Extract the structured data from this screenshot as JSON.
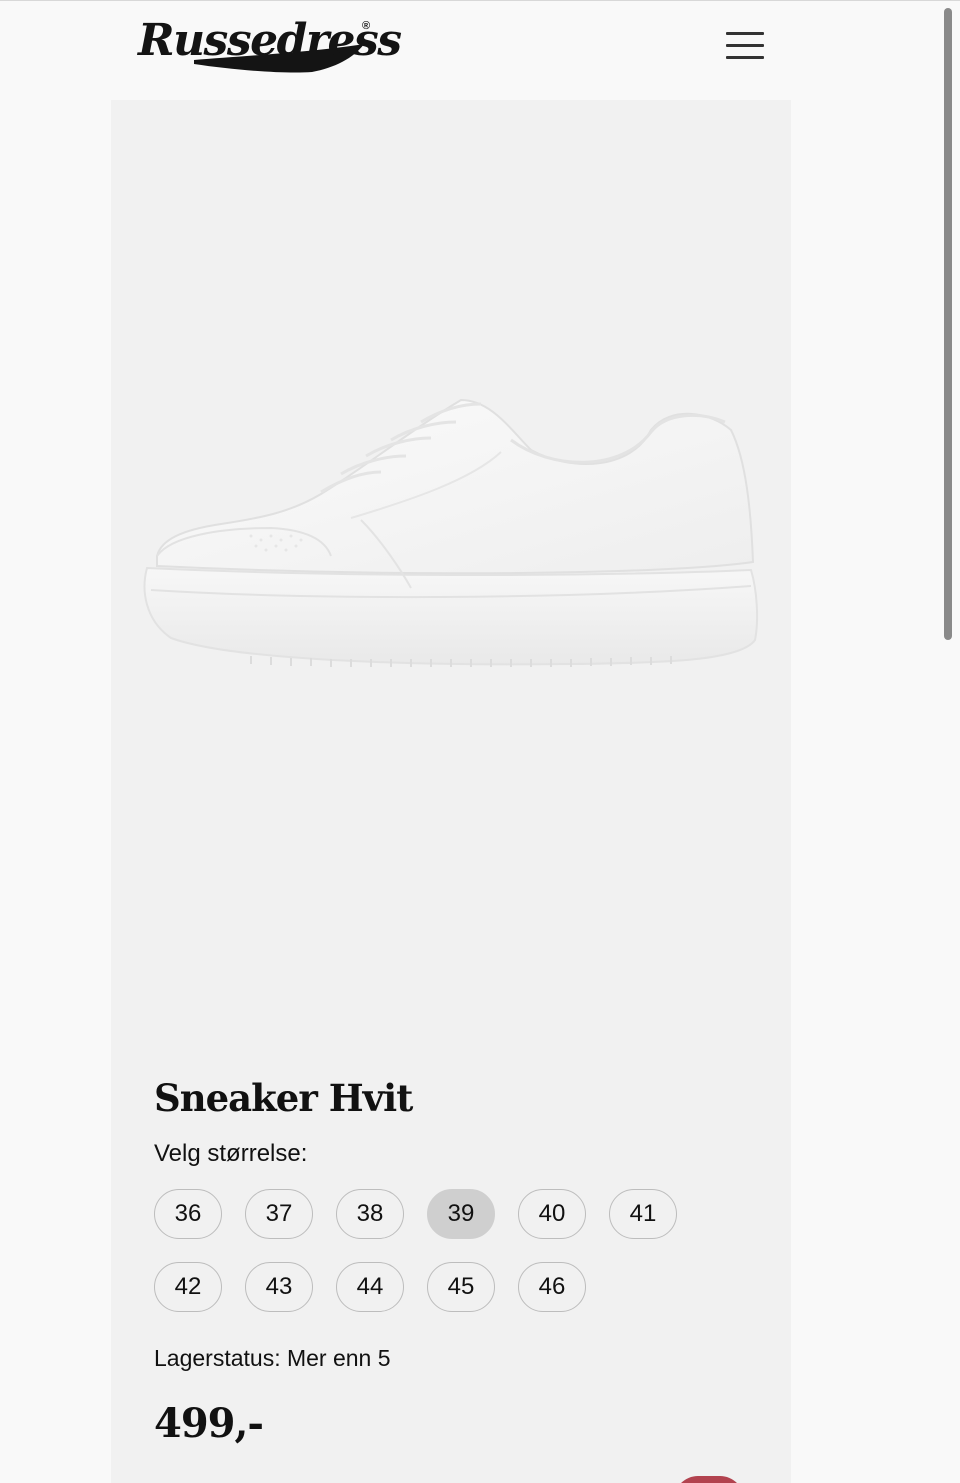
{
  "header": {
    "logo_text": "Russedress",
    "logo_mark": "®",
    "menu_icon": "hamburger-menu-icon"
  },
  "product": {
    "image_icon": "white-sneaker-image",
    "title": "Sneaker Hvit",
    "size_label": "Velg størrelse:",
    "sizes": [
      "36",
      "37",
      "38",
      "39",
      "40",
      "41",
      "42",
      "43",
      "44",
      "45",
      "46"
    ],
    "selected_size": "39",
    "stock_status": "Lagerstatus: Mer enn 5",
    "price": "499,-"
  },
  "colors": {
    "page_background": "#f9f9f9",
    "card_background": "#f1f1f1",
    "selected_size_background": "#cfcfcf",
    "size_border": "#bdbdbd",
    "cart_accent": "#b2434f",
    "text": "#111111"
  }
}
